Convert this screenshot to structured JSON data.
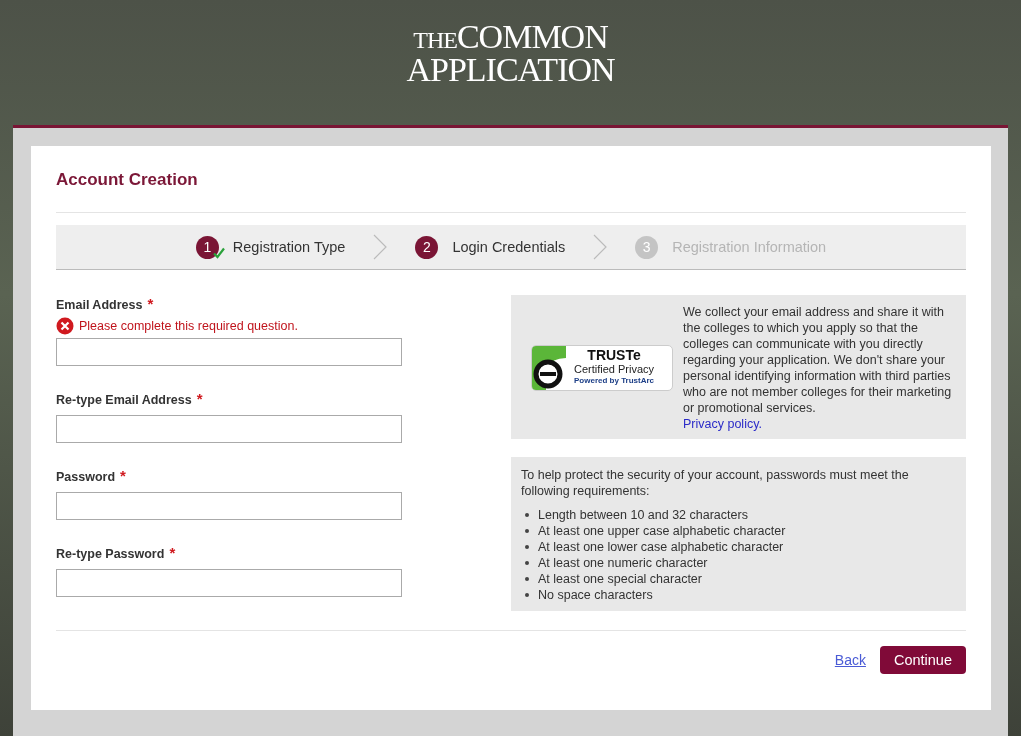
{
  "logo": {
    "line_1_small": "THE",
    "line_1": "COMMON",
    "line_2": "APPLICATION"
  },
  "title": "Account Creation",
  "steps": [
    {
      "number": "1",
      "label": "Registration Type",
      "completed": true,
      "disabled": false
    },
    {
      "number": "2",
      "label": "Login Credentials",
      "completed": false,
      "disabled": false
    },
    {
      "number": "3",
      "label": "Registration Information",
      "completed": false,
      "disabled": true
    }
  ],
  "fields": [
    {
      "label": "Email Address",
      "required_mark": "*",
      "error": "Please complete this required question."
    },
    {
      "label": "Re-type Email Address",
      "required_mark": "*"
    },
    {
      "label": "Password",
      "required_mark": "*"
    },
    {
      "label": "Re-type Password",
      "required_mark": "*"
    }
  ],
  "privacy": {
    "badge": {
      "title": "TRUSTe",
      "subtitle": "Certified Privacy",
      "powered": "Powered by TrustArc"
    },
    "text": "We collect your email address and share it with the colleges to which you apply so that the colleges can communicate with you directly regarding your application. We don't share your personal identifying information with third parties who are not member colleges for their marketing or promotional services.",
    "link": "Privacy policy."
  },
  "password_rules": {
    "intro": "To help protect the security of your account, passwords must meet the following requirements:",
    "items": [
      "Length between 10 and 32 characters",
      "At least one upper case alphabetic character",
      "At least one lower case alphabetic character",
      "At least one numeric character",
      "At least one special character",
      "No space characters"
    ]
  },
  "buttons": {
    "back": "Back",
    "continue": "Continue"
  }
}
